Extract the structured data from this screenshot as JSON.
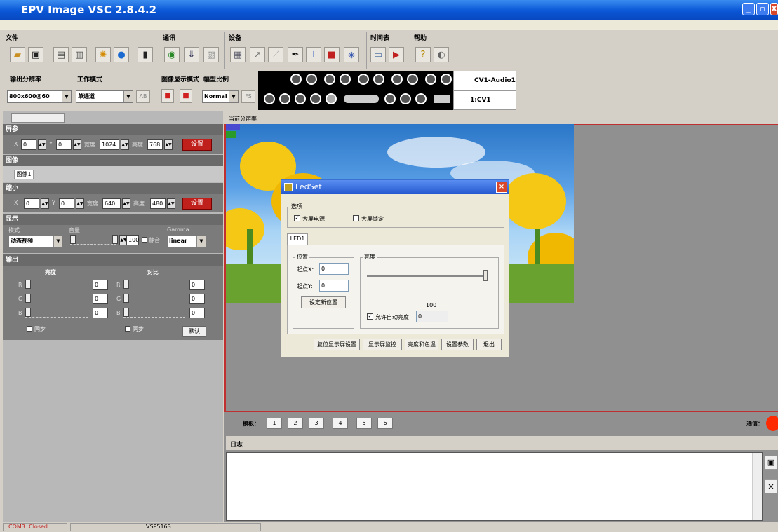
{
  "app": {
    "title": "EPV Image VSC  2.8.4.2"
  },
  "window_buttons": [
    "_",
    "▫",
    "X"
  ],
  "menu": {
    "items": [
      "",
      ""
    ]
  },
  "toolbar": {
    "groups": [
      {
        "label": "文件"
      },
      {
        "label": "通讯"
      },
      {
        "label": "设备"
      },
      {
        "label": "时间表"
      },
      {
        "label": "帮助"
      }
    ]
  },
  "settings": {
    "output_res_label": "输出分辨率",
    "output_res_value": "800x600@60",
    "work_mode_label": "工作模式",
    "work_mode_value": "单通道",
    "ab_label": "AB",
    "display_mode_label": "图像显示模式",
    "aspect_label": "幅型比例",
    "aspect_value": "Normal",
    "fs_label": "FS"
  },
  "source": {
    "audio_label": "CV1-Audio1",
    "input_label": "1:CV1"
  },
  "left_panel": {
    "tab": "",
    "screen": {
      "header": "屏参",
      "x_label": "X",
      "x": "0",
      "y_label": "Y",
      "y": "0",
      "w_label": "宽度",
      "w": "1024",
      "h_label": "高度",
      "h": "768",
      "set": "设置"
    },
    "image": {
      "header": "图像",
      "tab": "图像1"
    },
    "scale": {
      "header": "缩小",
      "x_label": "X",
      "x": "0",
      "y_label": "Y",
      "y": "0",
      "w_label": "宽度",
      "w": "640",
      "h_label": "高度",
      "h": "480",
      "set": "设置"
    },
    "display": {
      "header": "显示",
      "mode_label": "模式",
      "mode_value": "动态视频",
      "volume_label": "音量",
      "volume_value": "100",
      "mute_label": "静音",
      "gamma_label": "Gamma",
      "gamma_value": "linear"
    },
    "output": {
      "header": "输出",
      "brightness_label": "亮度",
      "contrast_label": "对比",
      "channels": [
        "R",
        "G",
        "B"
      ],
      "brightness_values": [
        "0",
        "0",
        "0"
      ],
      "contrast_values": [
        "0",
        "0",
        "0"
      ],
      "sync_label": "同步",
      "default_label": "默认"
    }
  },
  "preview": {
    "header": "当前分辨率",
    "tag1": "",
    "tag2": ""
  },
  "dialog": {
    "title": "LedSet",
    "options_label": "选项",
    "power_label": "大屏电源",
    "lock_label": "大屏锁定",
    "tab": "LED1",
    "position_label": "位置",
    "startx_label": "起点X:",
    "startx": "0",
    "starty_label": "起点Y:",
    "starty": "0",
    "set_pos": "设定新位置",
    "brightness_label": "亮度",
    "brightness_value": "100",
    "auto_label": "允许自动亮度",
    "auto_value": "0",
    "buttons": [
      "复位显示屏设置",
      "显示屏监控",
      "亮度和色温",
      "设置参数",
      "退出"
    ]
  },
  "mode_bar": {
    "label": "模板：",
    "buttons": [
      "1",
      "2",
      "3",
      "4",
      "5",
      "6"
    ],
    "comm_label": "通信："
  },
  "log": {
    "label": "日志"
  },
  "status": {
    "com": "COM3: Closed.",
    "device": "VSP516S"
  }
}
